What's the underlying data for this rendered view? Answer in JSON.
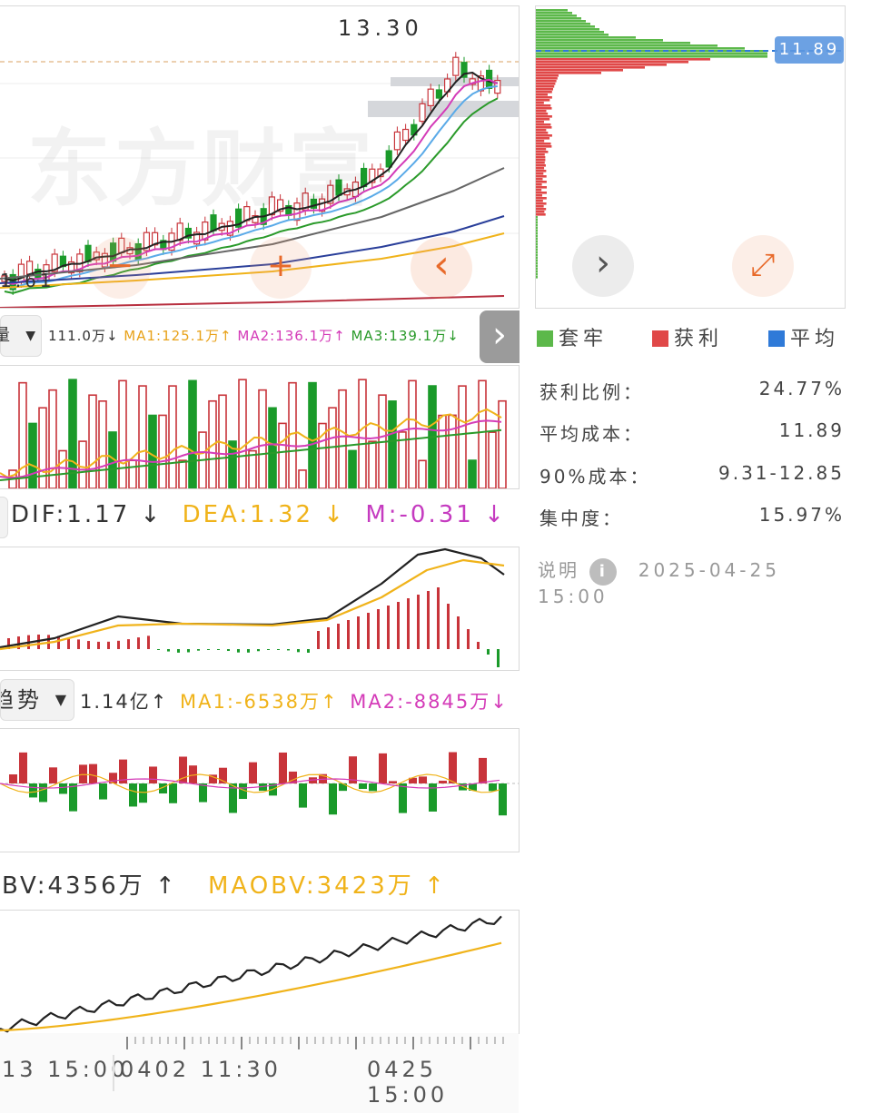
{
  "watermark": "东方财富",
  "kline": {
    "high_label": "13.30",
    "low_label": "1.61",
    "buttons": {
      "next": "›",
      "cross": "+",
      "prev": "‹",
      "minus": "−"
    }
  },
  "chip": {
    "avg_price": "11.89",
    "buttons": {
      "next": "›",
      "expand": "⤢"
    },
    "legend": [
      {
        "label": "套牢",
        "color": "#5cb84a"
      },
      {
        "label": "获利",
        "color": "#e04848"
      },
      {
        "label": "平均",
        "color": "#2f7ad8"
      }
    ],
    "rows": [
      {
        "label": "获利比例：",
        "value": "24.77%"
      },
      {
        "label": "平均成本：",
        "value": "11.89"
      },
      {
        "label": "90%成本：",
        "value": "9.31-12.85"
      },
      {
        "label": "集中度：",
        "value": "15.97%"
      }
    ],
    "note_label": "说明",
    "datetime": "2025-04-25 15:00"
  },
  "volume": {
    "selector": "量",
    "vol": "111.0万↓",
    "ma1": "MA1:125.1万↑",
    "ma2": "MA2:136.1万↑",
    "ma3": "MA3:139.1万↓",
    "expand": "›"
  },
  "macd": {
    "dif": "DIF:1.17 ↓",
    "dea": "DEA:1.32 ↓",
    "m": "M:-0.31 ↓"
  },
  "capital": {
    "selector": "趋势",
    "val": "1.14亿↑",
    "ma1": "MA1:-6538万↑",
    "ma2": "MA2:-8845万↓"
  },
  "obv": {
    "obv": "BV:4356万 ↑",
    "maobv": "MAOBV:3423万 ↑"
  },
  "time_axis": {
    "left": "13 15:00",
    "mid": "0402 11:30",
    "right": "0425 15:00"
  },
  "colors": {
    "up": "#c8343a",
    "down": "#1a9a2a",
    "ma_yellow": "#f0b31a",
    "ma_magenta": "#d43bb8",
    "ma_green": "#2a9a2a",
    "accent_orange": "#e86a2a"
  }
}
